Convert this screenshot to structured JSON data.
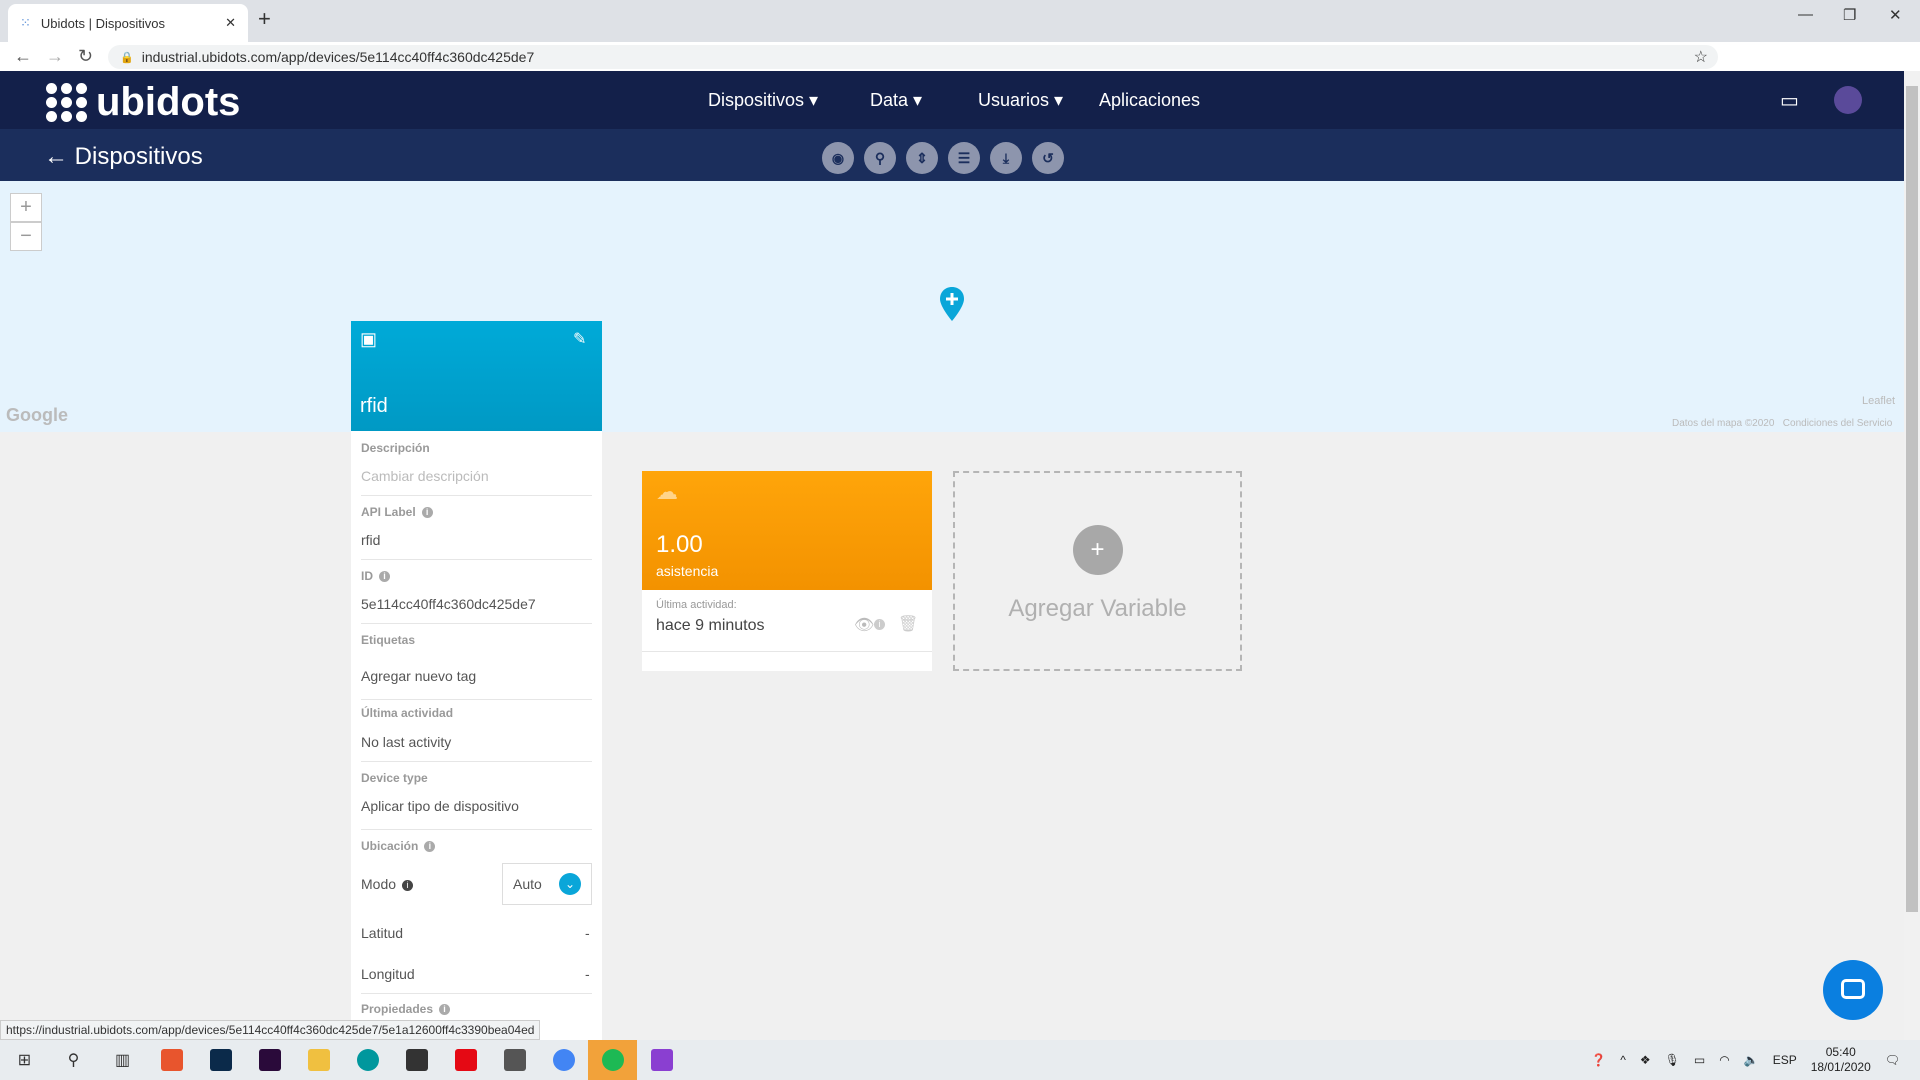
{
  "browser": {
    "tab_title": "Ubidots | Dispositivos",
    "url": "industrial.ubidots.com/app/devices/5e114cc40ff4c360dc425de7",
    "status_url": "https://industrial.ubidots.com/app/devices/5e114cc40ff4c360dc425de7/5e1a12600ff4c3390bea04ed"
  },
  "nav": {
    "logo": "ubidots",
    "items": [
      "Dispositivos",
      "Data",
      "Usuarios",
      "Aplicaciones"
    ],
    "back_label": "Dispositivos"
  },
  "map": {
    "google": "Google",
    "leaflet": "Leaflet",
    "attribution": "Datos del mapa ©2020",
    "terms": "Condiciones del Servicio",
    "zoom_in": "+",
    "zoom_out": "−"
  },
  "device": {
    "name": "rfid",
    "description_label": "Descripción",
    "description_placeholder": "Cambiar descripción",
    "api_label_label": "API Label",
    "api_label": "rfid",
    "id_label": "ID",
    "id": "5e114cc40ff4c360dc425de7",
    "tags_label": "Etiquetas",
    "tags_value": "Agregar nuevo tag",
    "last_activity_label": "Última actividad",
    "last_activity": "No last activity",
    "device_type_label": "Device type",
    "device_type": "Aplicar tipo de dispositivo",
    "location_label": "Ubicación",
    "mode_label": "Modo",
    "mode_value": "Auto",
    "lat_label": "Latitud",
    "lat": "-",
    "lon_label": "Longitud",
    "lon": "-",
    "properties_label": "Propiedades"
  },
  "variable": {
    "value": "1.00",
    "name": "asistencia",
    "last_label": "Última actividad:",
    "last": "hace 9 minutos",
    "color": "#ffa50a"
  },
  "add_variable": {
    "plus": "+",
    "label": "Agregar Variable"
  },
  "taskbar": {
    "lang": "ESP",
    "time": "05:40",
    "date": "18/01/2020"
  }
}
